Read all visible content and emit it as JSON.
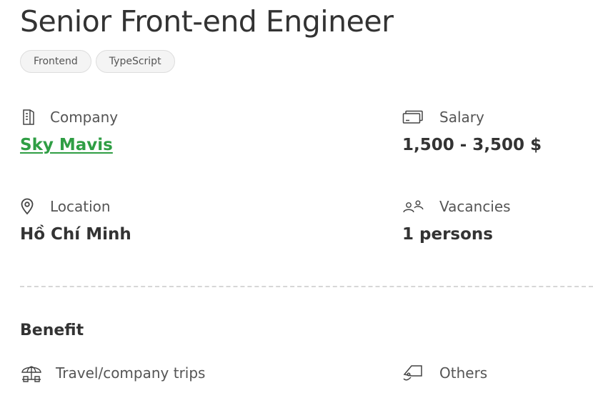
{
  "job": {
    "title": "Senior Front-end Engineer",
    "tags": [
      "Frontend",
      "TypeScript"
    ]
  },
  "info": {
    "company": {
      "label": "Company",
      "value": "Sky Mavis",
      "icon": "building-icon"
    },
    "salary": {
      "label": "Salary",
      "value": "1,500 - 3,500 $",
      "icon": "money-icon"
    },
    "location": {
      "label": "Location",
      "value": "Hồ Chí Minh",
      "icon": "location-pin-icon"
    },
    "vacancies": {
      "label": "Vacancies",
      "value": "1 persons",
      "icon": "people-icon"
    }
  },
  "benefits": {
    "title": "Benefit",
    "items": [
      {
        "label": "Travel/company trips",
        "icon": "beach-umbrella-icon"
      },
      {
        "label": "Others",
        "icon": "tag-icon"
      }
    ]
  },
  "colors": {
    "link": "#2f9e44",
    "text": "#333333",
    "muted": "#555555"
  }
}
